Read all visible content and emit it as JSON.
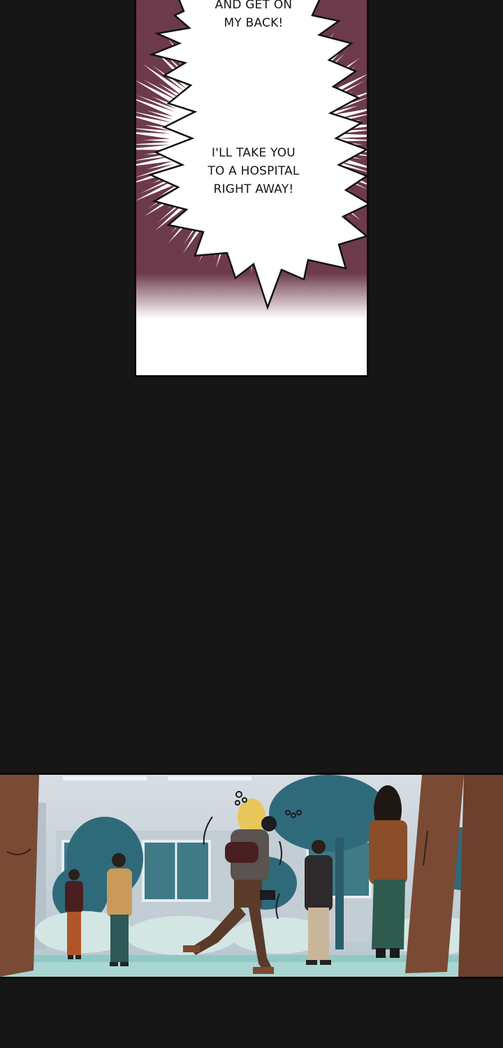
{
  "panels": [
    {
      "id": "panel-1",
      "bubble_lines": [
        "AND GET ON",
        "MY BACK!"
      ],
      "bubble2_lines": [
        "I'LL TAKE YOU",
        "TO A HOSPITAL",
        "RIGHT AWAY!"
      ]
    },
    {
      "id": "panel-2"
    }
  ],
  "colors": {
    "background": "#161616",
    "speedline": "#6d3a4c",
    "sky": "#c9d4dc",
    "trees": "#2f6a7a",
    "ground": "#8fc9c4"
  }
}
